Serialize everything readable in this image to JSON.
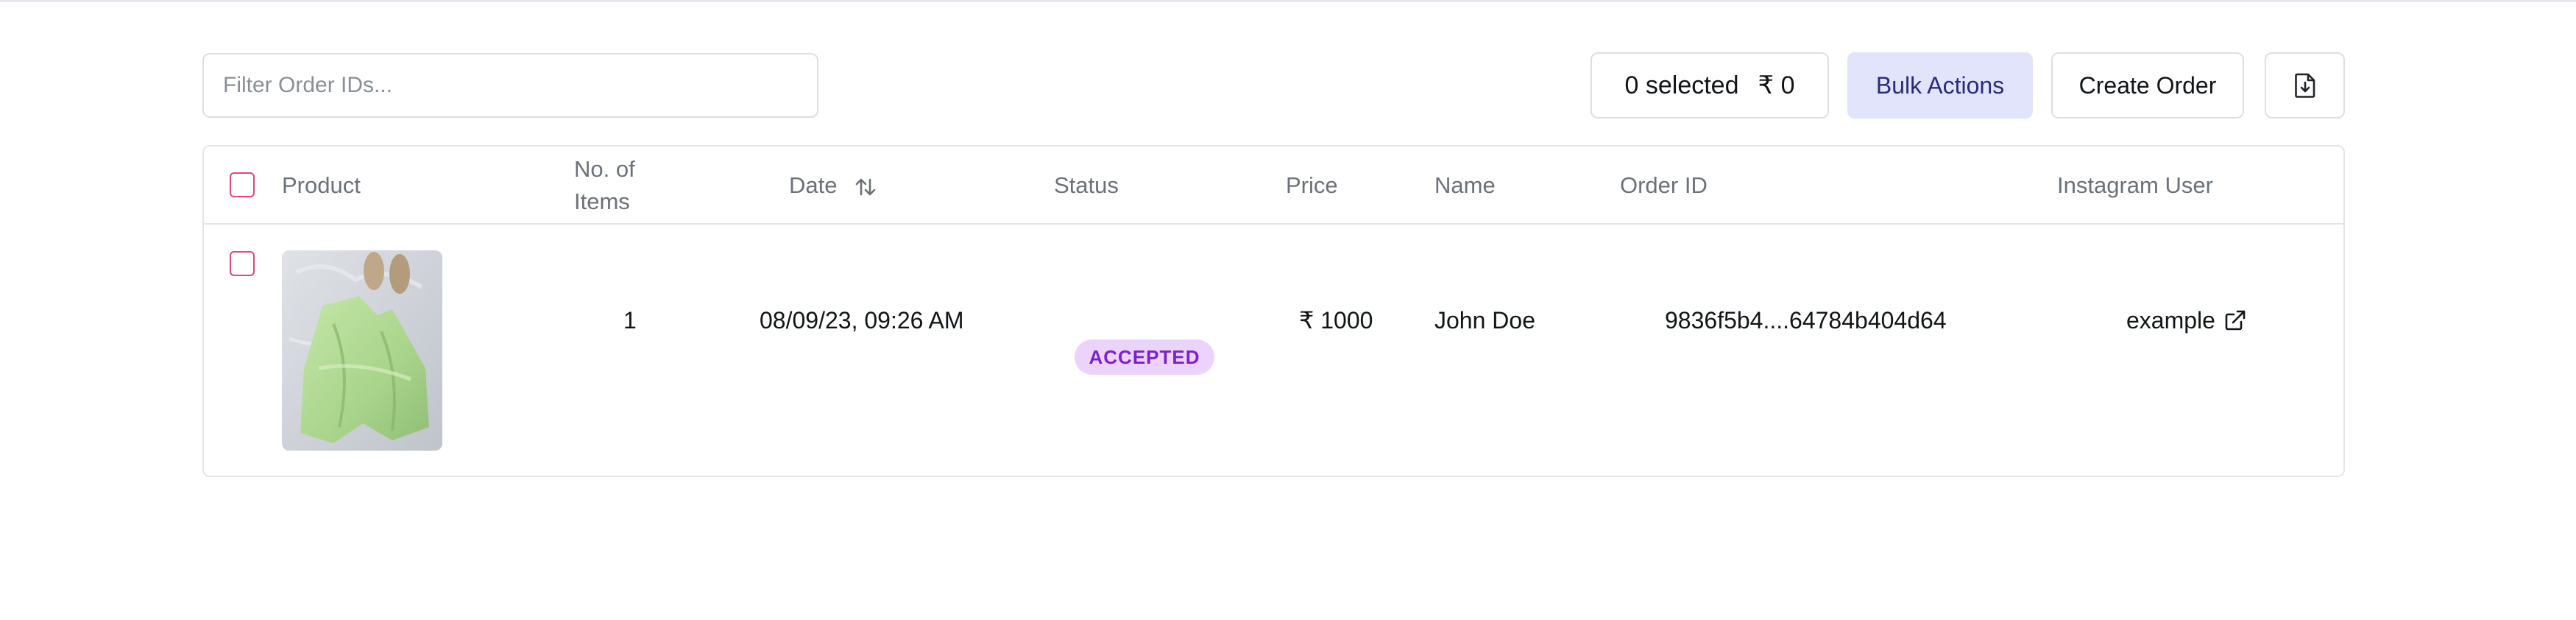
{
  "toolbar": {
    "filter_placeholder": "Filter Order IDs...",
    "selected_count": "0 selected",
    "selected_amount": "₹ 0",
    "bulk_actions_label": "Bulk Actions",
    "create_order_label": "Create Order",
    "export_icon": "file-download-icon"
  },
  "table": {
    "columns": [
      "Product",
      "No. of",
      "Items",
      "Date",
      "Status",
      "Price",
      "Name",
      "Order ID",
      "Instagram User"
    ],
    "rows": [
      {
        "items": "1",
        "date": "08/09/23, 09:26 AM",
        "status": "ACCEPTED",
        "price": "₹ 1000",
        "name": "John Doe",
        "order_id": "9836f5b4....64784b404d64",
        "instagram_user": "example"
      }
    ]
  },
  "colors": {
    "accent_checkbox": "#e0467a",
    "bulk_bg": "#e1e4fb",
    "bulk_text": "#2d2a7a",
    "status_bg": "#ecd3fb",
    "status_text": "#7b22c9"
  }
}
